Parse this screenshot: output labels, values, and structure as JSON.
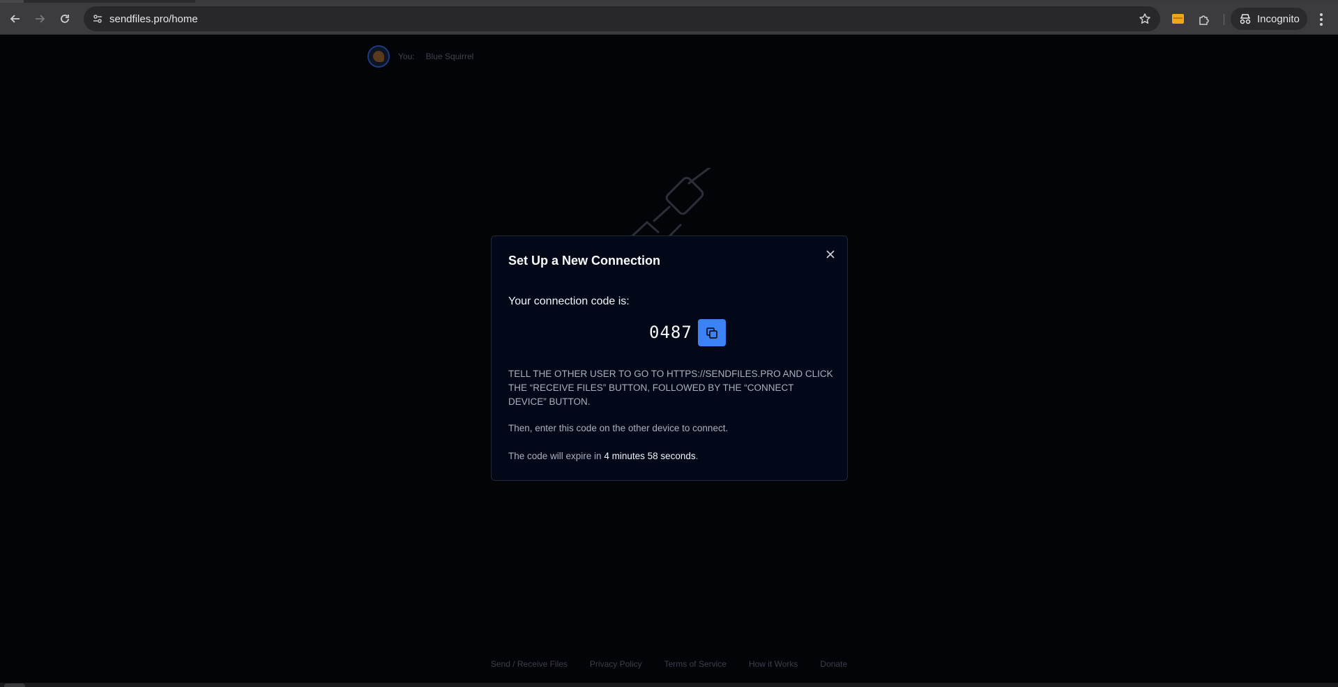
{
  "browser": {
    "url": "sendfiles.pro/home",
    "profile_label": "Incognito"
  },
  "page": {
    "user": {
      "you_label": "You:",
      "name": "Blue Squirrel"
    },
    "footer": {
      "links": [
        "Send / Receive Files",
        "Privacy Policy",
        "Terms of Service",
        "How it Works",
        "Donate"
      ]
    }
  },
  "modal": {
    "title": "Set Up a New Connection",
    "code_label": "Your connection code is:",
    "code": "0487",
    "instructions": "Tell the other user to go to https://sendfiles.pro and click the “Receive Files” button, followed by the “Connect Device” button.",
    "then_text": "Then, enter this code on the other device to connect.",
    "expire_prefix": "The code will expire in ",
    "expire_time": "4 minutes 58 seconds",
    "expire_suffix": "."
  },
  "colors": {
    "accent": "#3b82f6",
    "modal_bg": "#020817",
    "page_bg": "#030408"
  }
}
